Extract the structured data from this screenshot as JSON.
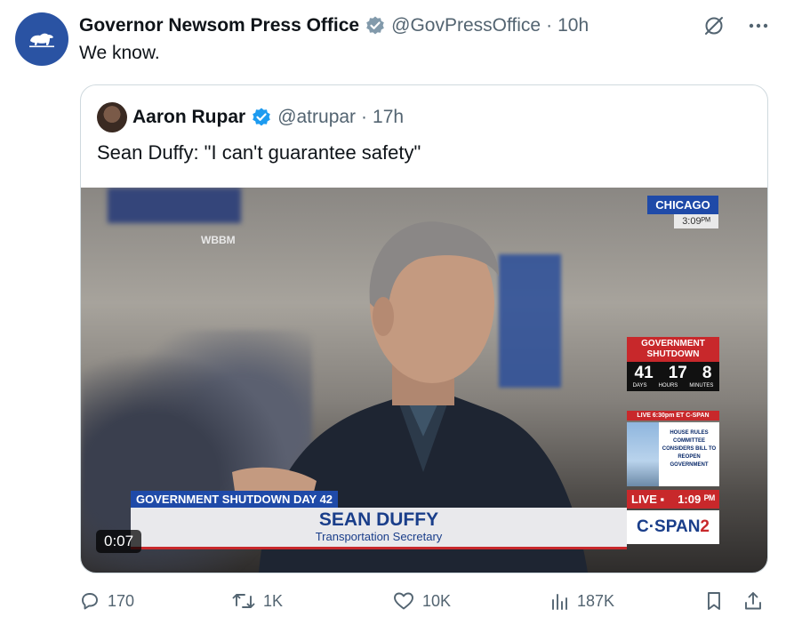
{
  "tweet": {
    "author_name": "Governor Newsom Press Office",
    "handle": "@GovPressOffice",
    "separator": "·",
    "time": "10h",
    "text": "We know."
  },
  "quoted": {
    "author_name": "Aaron Rupar",
    "handle": "@atrupar",
    "separator": "·",
    "time": "17h",
    "text": "Sean Duffy: \"I can't guarantee safety\"",
    "video": {
      "duration": "0:07",
      "station_logo": "WBBM",
      "location": "CHICAGO",
      "location_time": "3:09ᴾᴹ",
      "shutdown_label": "GOVERNMENT SHUTDOWN",
      "counter": {
        "days": "41",
        "hours": "17",
        "minutes": "8"
      },
      "counter_units": {
        "days": "DAYS",
        "hours": "HOURS",
        "minutes": "MINUTES"
      },
      "schedule_text": "LIVE 6:30pm ET C-SPAN",
      "promo_text": "HOUSE RULES COMMITTEE CONSIDERS BILL TO REOPEN GOVERNMENT",
      "live_label": "LIVE ▪",
      "live_time": "1:09 ᴾᴹ",
      "network": "C·SPAN",
      "network_number": "2",
      "lower_third_tag": "GOVERNMENT SHUTDOWN DAY 42",
      "speaker_name": "SEAN DUFFY",
      "speaker_title": "Transportation Secretary"
    }
  },
  "actions": {
    "replies": "170",
    "reposts": "1K",
    "likes": "10K",
    "views": "187K"
  },
  "colors": {
    "brand_blue": "#2a53a3",
    "verified_blue": "#1d9bf0",
    "secondary_text": "#536471",
    "cspan_red": "#c8282b"
  }
}
